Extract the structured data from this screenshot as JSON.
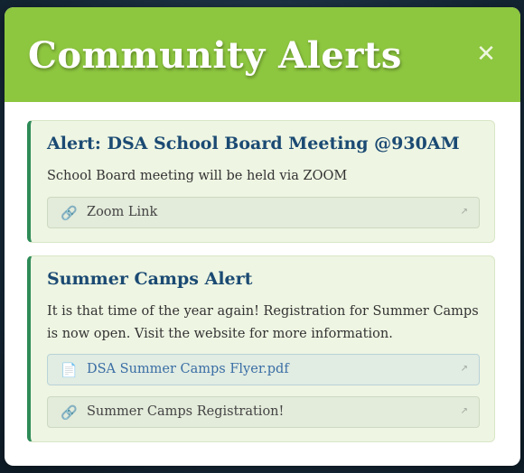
{
  "modal": {
    "title": "Community Alerts",
    "close_glyph": "✕"
  },
  "alerts": [
    {
      "title": "Alert: DSA School Board Meeting @930AM",
      "text": "School Board meeting will be held via ZOOM",
      "links": [
        {
          "label": "Zoom Link",
          "icon": "link-icon",
          "glyph": "🔗",
          "ext_glyph": "↗"
        }
      ]
    },
    {
      "title": "Summer Camps Alert",
      "text": "It is that time of the year again! Registration for Summer Camps is now open. Visit the website for more information.",
      "links": [
        {
          "label": "DSA Summer Camps Flyer.pdf",
          "icon": "document-icon",
          "glyph": "📄",
          "ext_glyph": "↗"
        },
        {
          "label": "Summer Camps Registration!",
          "icon": "link-icon",
          "glyph": "🔗",
          "ext_glyph": "↗"
        }
      ]
    }
  ],
  "colors": {
    "header": "#8dc63f",
    "card_bg": "#eef5e2",
    "card_accent": "#2e8b57",
    "card_title": "#1b4a73",
    "file_link": "#3a6ea5"
  }
}
